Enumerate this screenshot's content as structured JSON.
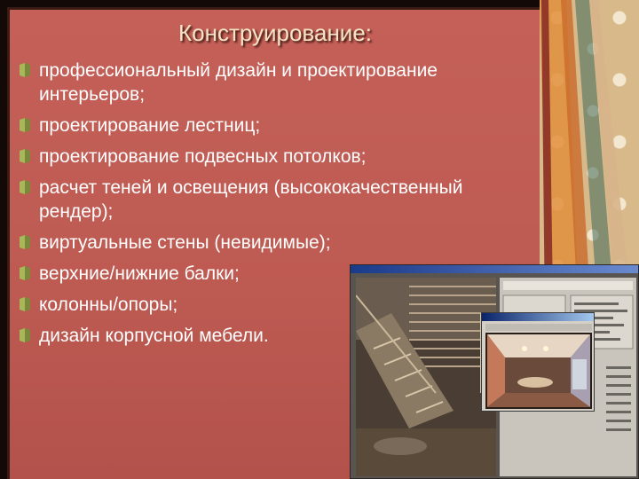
{
  "slide": {
    "title": "Конструирование:",
    "items": [
      "профессиональный дизайн и проектирование интерьеров;",
      "проектирование лестниц;",
      "проектирование подвесных потолков;",
      "расчет теней и освещения (высококачественный рендер);",
      "виртуальные стены (невидимые);",
      "верхние/нижние балки;",
      "колонны/опоры;",
      "дизайн корпусной мебели."
    ]
  },
  "icons": {
    "bullet": "bullet-icon"
  },
  "colors": {
    "panel": "#c46058",
    "title": "#f4e3c4",
    "text": "#ffffff",
    "bullet": "#7a8a3a"
  }
}
